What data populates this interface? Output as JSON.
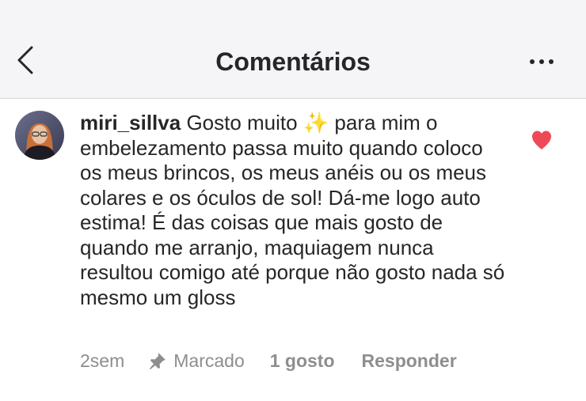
{
  "header": {
    "title": "Comentários",
    "back_icon": "chevron-left-icon",
    "more_icon": "more-horizontal-icon"
  },
  "comment": {
    "username": "miri_sillva",
    "text": "Gosto muito ✨ para mim o embelezamento passa muito quando coloco os meus brincos, os meus anéis ou os meus colares e os óculos de sol! Dá-me logo auto estima! É das coisas que mais gosto de quando me arranjo, maquiagem nunca resultou comigo até porque não gosto nada só mesmo um gloss",
    "time": "2sem",
    "pinned_label": "Marcado",
    "likes_label": "1 gosto",
    "reply_label": "Responder",
    "liked": true
  },
  "colors": {
    "header_bg": "#f5f5f7",
    "text": "#262626",
    "meta_text": "#8e8e8e",
    "heart": "#ed4956"
  }
}
